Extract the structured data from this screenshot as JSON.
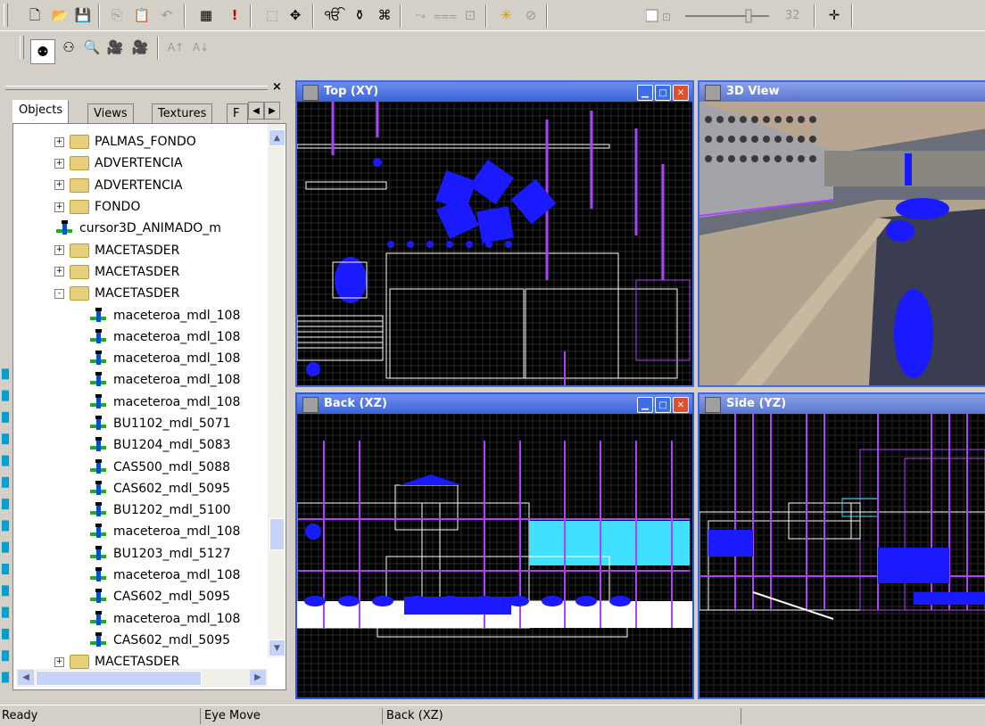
{
  "toolbar_top": {
    "buttons": [
      {
        "name": "new-file-icon",
        "glyph": "🗋"
      },
      {
        "name": "open-folder-icon",
        "glyph": "📂"
      },
      {
        "name": "save-icon",
        "glyph": "💾"
      },
      {
        "name": "copy-icon",
        "glyph": "⎘"
      },
      {
        "name": "paste-icon",
        "glyph": "📋"
      },
      {
        "name": "undo-icon",
        "glyph": "↶"
      },
      {
        "name": "build-icon",
        "glyph": "▦"
      },
      {
        "name": "run-alert-icon",
        "glyph": "!"
      },
      {
        "name": "select-tool-icon",
        "glyph": "⬚"
      },
      {
        "name": "move-tool-icon",
        "glyph": "✥"
      },
      {
        "name": "object-stack-icon",
        "glyph": "ੴ"
      },
      {
        "name": "object-group-icon",
        "glyph": "⚱"
      },
      {
        "name": "object-cam-icon",
        "glyph": "⌘"
      },
      {
        "name": "rotate-icon",
        "glyph": "⤳"
      },
      {
        "name": "align-icon",
        "glyph": "⩶"
      },
      {
        "name": "scale-icon",
        "glyph": "⊡"
      },
      {
        "name": "light-icon",
        "glyph": "✳"
      },
      {
        "name": "delete-object-icon",
        "glyph": "⊘"
      },
      {
        "name": "pan-cross-icon",
        "glyph": "✛"
      }
    ],
    "zoom_value": "32"
  },
  "toolbar_second": {
    "buttons": [
      {
        "name": "add-object-icon",
        "glyph": "⚉"
      },
      {
        "name": "add-child-icon",
        "glyph": "⚇"
      },
      {
        "name": "zoom-icon",
        "glyph": "🔍"
      },
      {
        "name": "camera-icon",
        "glyph": "🎥"
      },
      {
        "name": "camera-disabled-icon",
        "glyph": "🎥"
      },
      {
        "name": "sort-asc-icon",
        "glyph": "A↑"
      },
      {
        "name": "sort-desc-icon",
        "glyph": "A↓"
      }
    ]
  },
  "left_panel": {
    "tabs": [
      "Objects",
      "Views",
      "Textures",
      "F"
    ],
    "tree": [
      {
        "label": "PALMAS_FONDO",
        "type": "folder",
        "expander": "+",
        "indent": 0
      },
      {
        "label": "ADVERTENCIA",
        "type": "folder",
        "expander": "+",
        "indent": 0
      },
      {
        "label": "ADVERTENCIA",
        "type": "folder",
        "expander": "+",
        "indent": 0
      },
      {
        "label": "FONDO",
        "type": "folder",
        "expander": "+",
        "indent": 0
      },
      {
        "label": "cursor3D_ANIMADO_m",
        "type": "object",
        "expander": "",
        "indent": 0
      },
      {
        "label": "MACETASDER",
        "type": "folder",
        "expander": "+",
        "indent": 0
      },
      {
        "label": "MACETASDER",
        "type": "folder",
        "expander": "+",
        "indent": 0
      },
      {
        "label": "MACETASDER",
        "type": "folder",
        "expander": "-",
        "indent": 0
      },
      {
        "label": "maceteroa_mdl_108",
        "type": "object",
        "expander": "",
        "indent": 1
      },
      {
        "label": "maceteroa_mdl_108",
        "type": "object",
        "expander": "",
        "indent": 1
      },
      {
        "label": "maceteroa_mdl_108",
        "type": "object",
        "expander": "",
        "indent": 1
      },
      {
        "label": "maceteroa_mdl_108",
        "type": "object",
        "expander": "",
        "indent": 1
      },
      {
        "label": "maceteroa_mdl_108",
        "type": "object",
        "expander": "",
        "indent": 1
      },
      {
        "label": "BU1102_mdl_5071",
        "type": "object",
        "expander": "",
        "indent": 1
      },
      {
        "label": "BU1204_mdl_5083",
        "type": "object",
        "expander": "",
        "indent": 1
      },
      {
        "label": "CAS500_mdl_5088",
        "type": "object",
        "expander": "",
        "indent": 1
      },
      {
        "label": "CAS602_mdl_5095",
        "type": "object",
        "expander": "",
        "indent": 1
      },
      {
        "label": "BU1202_mdl_5100",
        "type": "object",
        "expander": "",
        "indent": 1
      },
      {
        "label": "maceteroa_mdl_108",
        "type": "object",
        "expander": "",
        "indent": 1
      },
      {
        "label": "BU1203_mdl_5127",
        "type": "object",
        "expander": "",
        "indent": 1
      },
      {
        "label": "maceteroa_mdl_108",
        "type": "object",
        "expander": "",
        "indent": 1
      },
      {
        "label": "CAS602_mdl_5095",
        "type": "object",
        "expander": "",
        "indent": 1
      },
      {
        "label": "maceteroa_mdl_108",
        "type": "object",
        "expander": "",
        "indent": 1
      },
      {
        "label": "CAS602_mdl_5095",
        "type": "object",
        "expander": "",
        "indent": 1
      },
      {
        "label": "MACETASDER",
        "type": "folder",
        "expander": "+",
        "indent": 0
      }
    ]
  },
  "viewports": {
    "top": {
      "title": "Top (XY)"
    },
    "view3d": {
      "title": "3D View"
    },
    "back": {
      "title": "Back (XZ)"
    },
    "side": {
      "title": "Side (YZ)"
    }
  },
  "status": {
    "ready": "Ready",
    "mode": "Eye Move",
    "active_view": "Back (XZ)"
  },
  "colors": {
    "viewport_border": "#3e6be0",
    "grid": "#2a2a2a",
    "wire_white": "#ffffff",
    "wire_purple": "#b040ff",
    "wire_blue": "#1a1aff",
    "wire_cyan": "#40e0ff"
  }
}
